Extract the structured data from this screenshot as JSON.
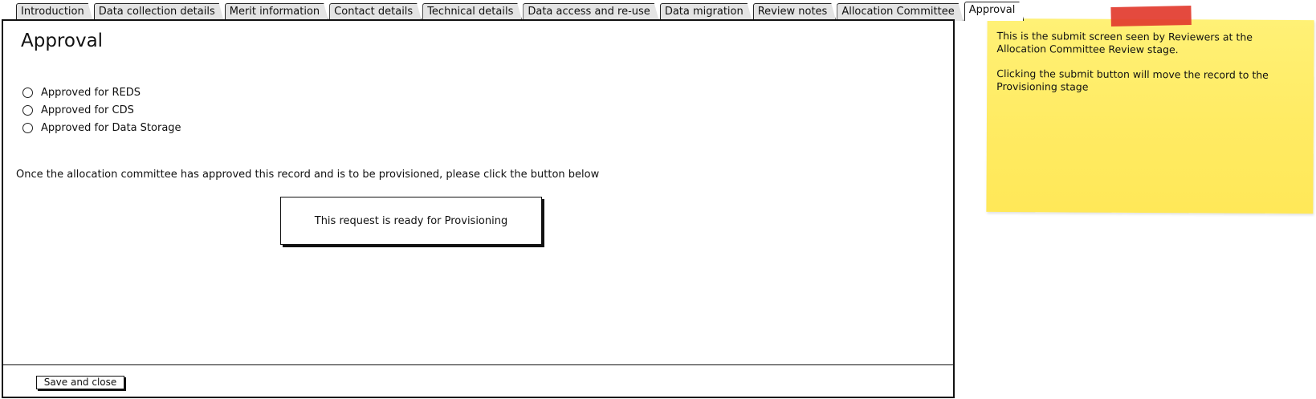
{
  "tabs": [
    {
      "label": "Introduction",
      "active": false
    },
    {
      "label": "Data collection details",
      "active": false
    },
    {
      "label": "Merit information",
      "active": false
    },
    {
      "label": "Contact details",
      "active": false
    },
    {
      "label": "Technical details",
      "active": false
    },
    {
      "label": "Data access and re-use",
      "active": false
    },
    {
      "label": "Data migration",
      "active": false
    },
    {
      "label": "Review notes",
      "active": false
    },
    {
      "label": "Allocation Committee",
      "active": false
    },
    {
      "label": "Approval",
      "active": true
    }
  ],
  "page": {
    "title": "Approval",
    "radio_options": [
      {
        "label": "Approved for REDS",
        "selected": false
      },
      {
        "label": "Approved for CDS",
        "selected": false
      },
      {
        "label": "Approved for Data Storage",
        "selected": false
      }
    ],
    "instruction": "Once the allocation committee has approved this record and is to be provisioned, please click the button below",
    "provision_button_label": "This request is ready for Provisioning",
    "save_button_label": "Save and close"
  },
  "note": {
    "paragraph_1": "This is the submit screen seen by Reviewers at the Allocation Committee Review stage.",
    "paragraph_2": "Clicking the submit button will move the record to the Provisioning stage",
    "color": "#ffee66",
    "tape_color": "#e23b2e"
  }
}
